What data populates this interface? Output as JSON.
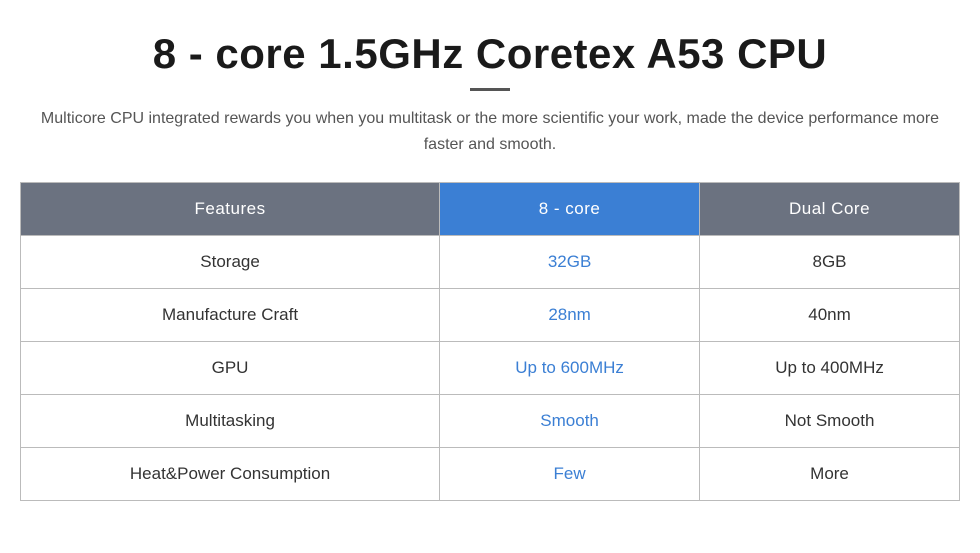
{
  "title": "8 - core 1.5GHz Coretex A53 CPU",
  "subtitle": "Multicore CPU integrated rewards you when you multitask or the more scientific your work, made the device performance more faster and smooth.",
  "table": {
    "headers": {
      "features": "Features",
      "core8": "8 - core",
      "dual": "Dual Core"
    },
    "rows": [
      {
        "feature": "Storage",
        "core8_val": "32GB",
        "dual_val": "8GB"
      },
      {
        "feature": "Manufacture Craft",
        "core8_val": "28nm",
        "dual_val": "40nm"
      },
      {
        "feature": "GPU",
        "core8_val": "Up to 600MHz",
        "dual_val": "Up to 400MHz"
      },
      {
        "feature": "Multitasking",
        "core8_val": "Smooth",
        "dual_val": "Not Smooth"
      },
      {
        "feature": "Heat&Power Consumption",
        "core8_val": "Few",
        "dual_val": "More"
      }
    ]
  }
}
